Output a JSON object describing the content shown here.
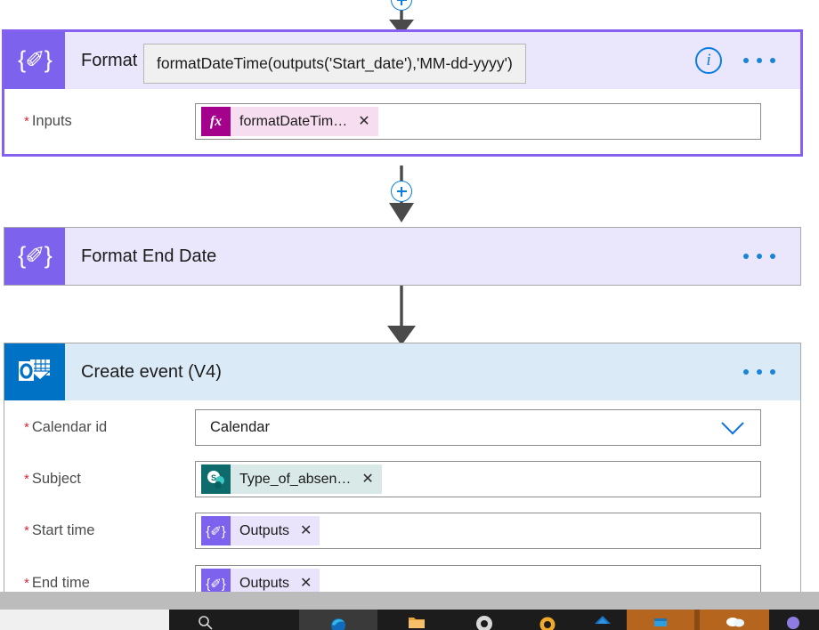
{
  "flow": {
    "cards": [
      {
        "id": "format-start-date",
        "title": "Format S",
        "full_title": "Format Start Date",
        "icon": "compose-icon",
        "icon_glyph": "{✐}",
        "selected": true,
        "has_info_icon": true,
        "has_ellipsis": true,
        "header_bg": "#eae6fb",
        "icon_bg": "#7d62ed",
        "fields": [
          {
            "label": "Inputs",
            "required": true,
            "type": "token",
            "token": {
              "icon": "fx-icon",
              "icon_text": "fx",
              "text": "formatDateTim…",
              "close": "✕",
              "chip_bg": "#f6ddef",
              "icon_bg": "#a4018c"
            }
          }
        ]
      },
      {
        "id": "format-end-date",
        "title": "Format End Date",
        "icon": "compose-icon",
        "icon_glyph": "{✐}",
        "selected": false,
        "has_info_icon": false,
        "has_ellipsis": true,
        "header_bg": "#eae6fb",
        "icon_bg": "#7d62ed",
        "fields": []
      },
      {
        "id": "create-event-v4",
        "title": "Create event (V4)",
        "icon": "outlook-icon",
        "selected": false,
        "has_info_icon": false,
        "has_ellipsis": true,
        "header_bg": "#dbeaf7",
        "icon_bg": "#0072c6",
        "fields": [
          {
            "label": "Calendar id",
            "required": true,
            "type": "dropdown",
            "value": "Calendar",
            "chevron": "chevron-down-icon"
          },
          {
            "label": "Subject",
            "required": true,
            "type": "token",
            "token": {
              "icon": "sharepoint-icon",
              "icon_text": "S",
              "text": "Type_of_absen…",
              "close": "✕",
              "chip_bg": "#d8e9e7",
              "icon_bg": "#0d6b6b"
            }
          },
          {
            "label": "Start time",
            "required": true,
            "type": "token",
            "token": {
              "icon": "compose-icon",
              "icon_text": "{✐}",
              "text": "Outputs",
              "close": "✕",
              "chip_bg": "#e9e3fb",
              "icon_bg": "#7d62ed"
            }
          },
          {
            "label": "End time",
            "required": true,
            "type": "token",
            "token": {
              "icon": "compose-icon",
              "icon_text": "{✐}",
              "text": "Outputs",
              "close": "✕",
              "chip_bg": "#e9e3fb",
              "icon_bg": "#7d62ed"
            }
          }
        ]
      }
    ],
    "connectors": [
      {
        "id": "connector-top",
        "has_plus": true
      },
      {
        "id": "connector-middle",
        "has_plus": true
      },
      {
        "id": "connector-bottom",
        "has_plus": false
      }
    ]
  },
  "tooltip": {
    "visible": true,
    "text": "formatDateTime(outputs('Start_date'),'MM-dd-yyyy')"
  },
  "required_marker": "*",
  "colors": {
    "selection_border": "#8661ef",
    "compose_purple": "#7d62ed",
    "outlook_blue": "#0072c6",
    "accent_blue": "#0a7de0",
    "required_red": "#d6283c",
    "fx_magenta": "#a4018c",
    "sharepoint_teal": "#0d6b6b"
  }
}
